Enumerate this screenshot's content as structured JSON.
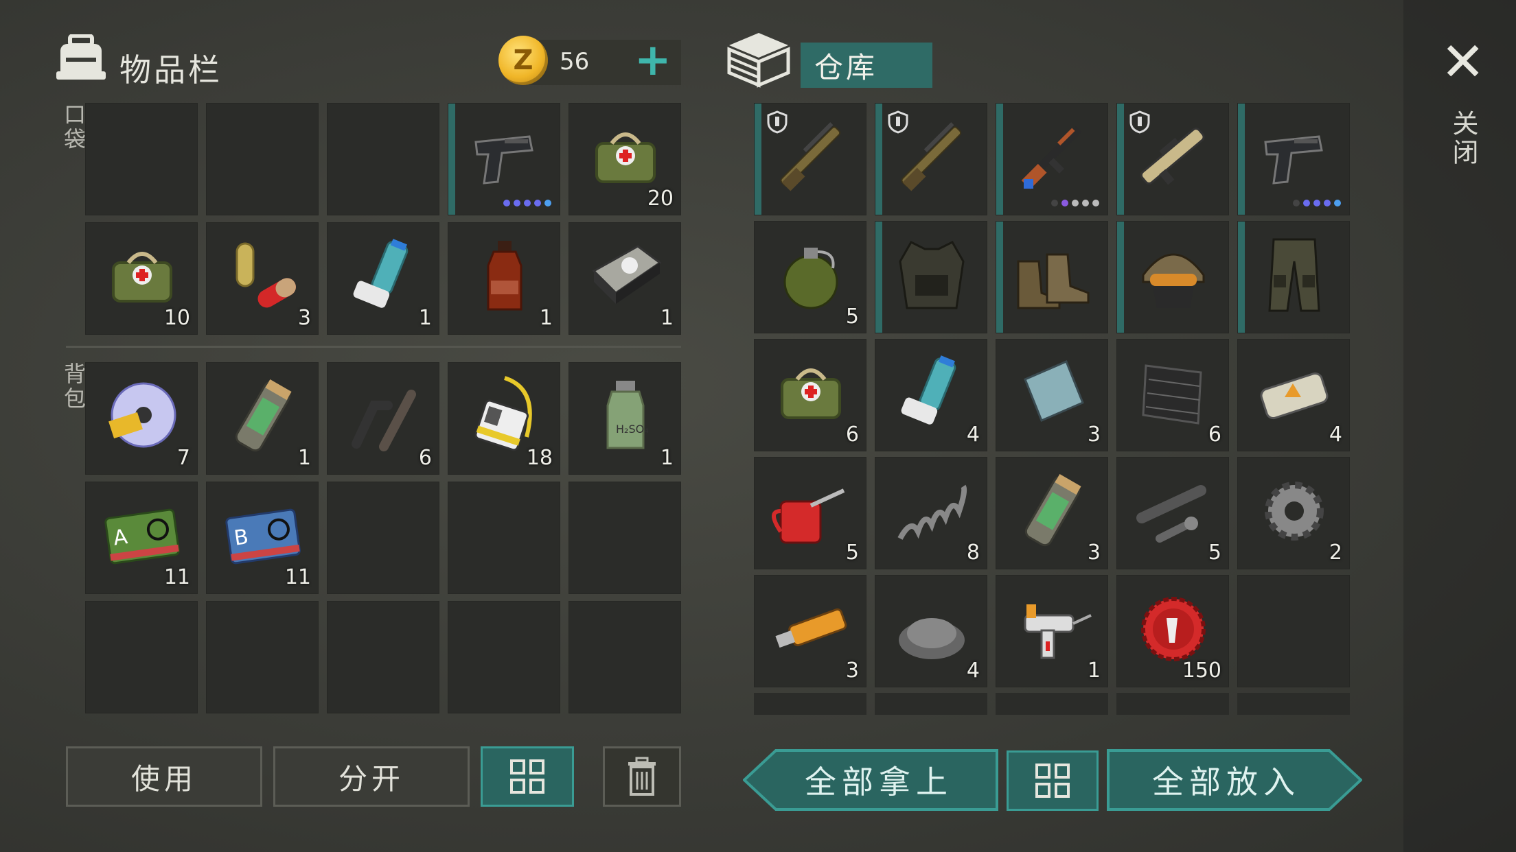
{
  "header": {
    "inventory_title": "物品栏",
    "coins": "56",
    "add_label": "+",
    "depot_title": "仓库",
    "close_label": "关闭"
  },
  "labels": {
    "pocket": "口袋",
    "backpack": "背包"
  },
  "inventory": {
    "pocket": [
      {
        "name": "empty"
      },
      {
        "name": "empty"
      },
      {
        "name": "empty"
      },
      {
        "name": "pistol",
        "count": "",
        "strip": true,
        "dots": [
          "#6a6cf0",
          "#6a6cf0",
          "#6a6cf0",
          "#6a6cf0",
          "#4d9ff0"
        ]
      },
      {
        "name": "medkit",
        "count": "20"
      },
      {
        "name": "medkit",
        "count": "10"
      },
      {
        "name": "pills",
        "count": "3"
      },
      {
        "name": "inhaler",
        "count": "1"
      },
      {
        "name": "spirit-bottle",
        "count": "1"
      },
      {
        "name": "hard-drive",
        "count": "1"
      }
    ],
    "backpack": [
      {
        "name": "cd-disc",
        "count": "7"
      },
      {
        "name": "canister",
        "count": "1"
      },
      {
        "name": "pipes",
        "count": "6"
      },
      {
        "name": "id-card",
        "count": "18"
      },
      {
        "name": "acid-jar",
        "count": "1"
      },
      {
        "name": "sector-card-a",
        "count": "11"
      },
      {
        "name": "sector-card-b",
        "count": "11"
      },
      {
        "name": "empty"
      },
      {
        "name": "empty"
      },
      {
        "name": "empty"
      },
      {
        "name": "empty"
      },
      {
        "name": "empty"
      },
      {
        "name": "empty"
      },
      {
        "name": "empty"
      },
      {
        "name": "empty"
      }
    ]
  },
  "depot": [
    {
      "name": "shotgun",
      "count": "",
      "strip": true,
      "shield": true
    },
    {
      "name": "shotgun",
      "count": "",
      "strip": true,
      "shield": true
    },
    {
      "name": "ak-rifle",
      "count": "",
      "strip": true,
      "dots": [
        "#444",
        "#8a5ae0",
        "#bbb",
        "#bbb",
        "#bbb"
      ]
    },
    {
      "name": "bullpup-rifle",
      "count": "",
      "strip": true,
      "shield": true
    },
    {
      "name": "pistol",
      "count": "",
      "strip": true,
      "dots": [
        "#444",
        "#6a6cf0",
        "#6a6cf0",
        "#6a6cf0",
        "#4d9ff0"
      ]
    },
    {
      "name": "grenade",
      "count": "5"
    },
    {
      "name": "vest",
      "count": "",
      "strip": true
    },
    {
      "name": "boots",
      "count": "",
      "strip": true
    },
    {
      "name": "helmet",
      "count": "",
      "strip": true
    },
    {
      "name": "pants",
      "count": "",
      "strip": true
    },
    {
      "name": "medkit",
      "count": "6"
    },
    {
      "name": "inhaler",
      "count": "4"
    },
    {
      "name": "metal-plate",
      "count": "3"
    },
    {
      "name": "mesh",
      "count": "6"
    },
    {
      "name": "explosive",
      "count": "4"
    },
    {
      "name": "oil-can",
      "count": "5"
    },
    {
      "name": "spring",
      "count": "8"
    },
    {
      "name": "canister",
      "count": "3"
    },
    {
      "name": "pipe-parts",
      "count": "5"
    },
    {
      "name": "gear",
      "count": "2"
    },
    {
      "name": "usb-stick",
      "count": "3"
    },
    {
      "name": "gravel",
      "count": "4"
    },
    {
      "name": "syringe-gun",
      "count": "1"
    },
    {
      "name": "bottle-cap",
      "count": "150"
    },
    {
      "name": "empty"
    }
  ],
  "buttons": {
    "use": "使用",
    "split": "分开",
    "take_all": "全部拿上",
    "put_all": "全部放入"
  },
  "colors": {
    "teal": "#2f6b66",
    "accent": "#3fb6ac",
    "coin": "#f0b628"
  }
}
